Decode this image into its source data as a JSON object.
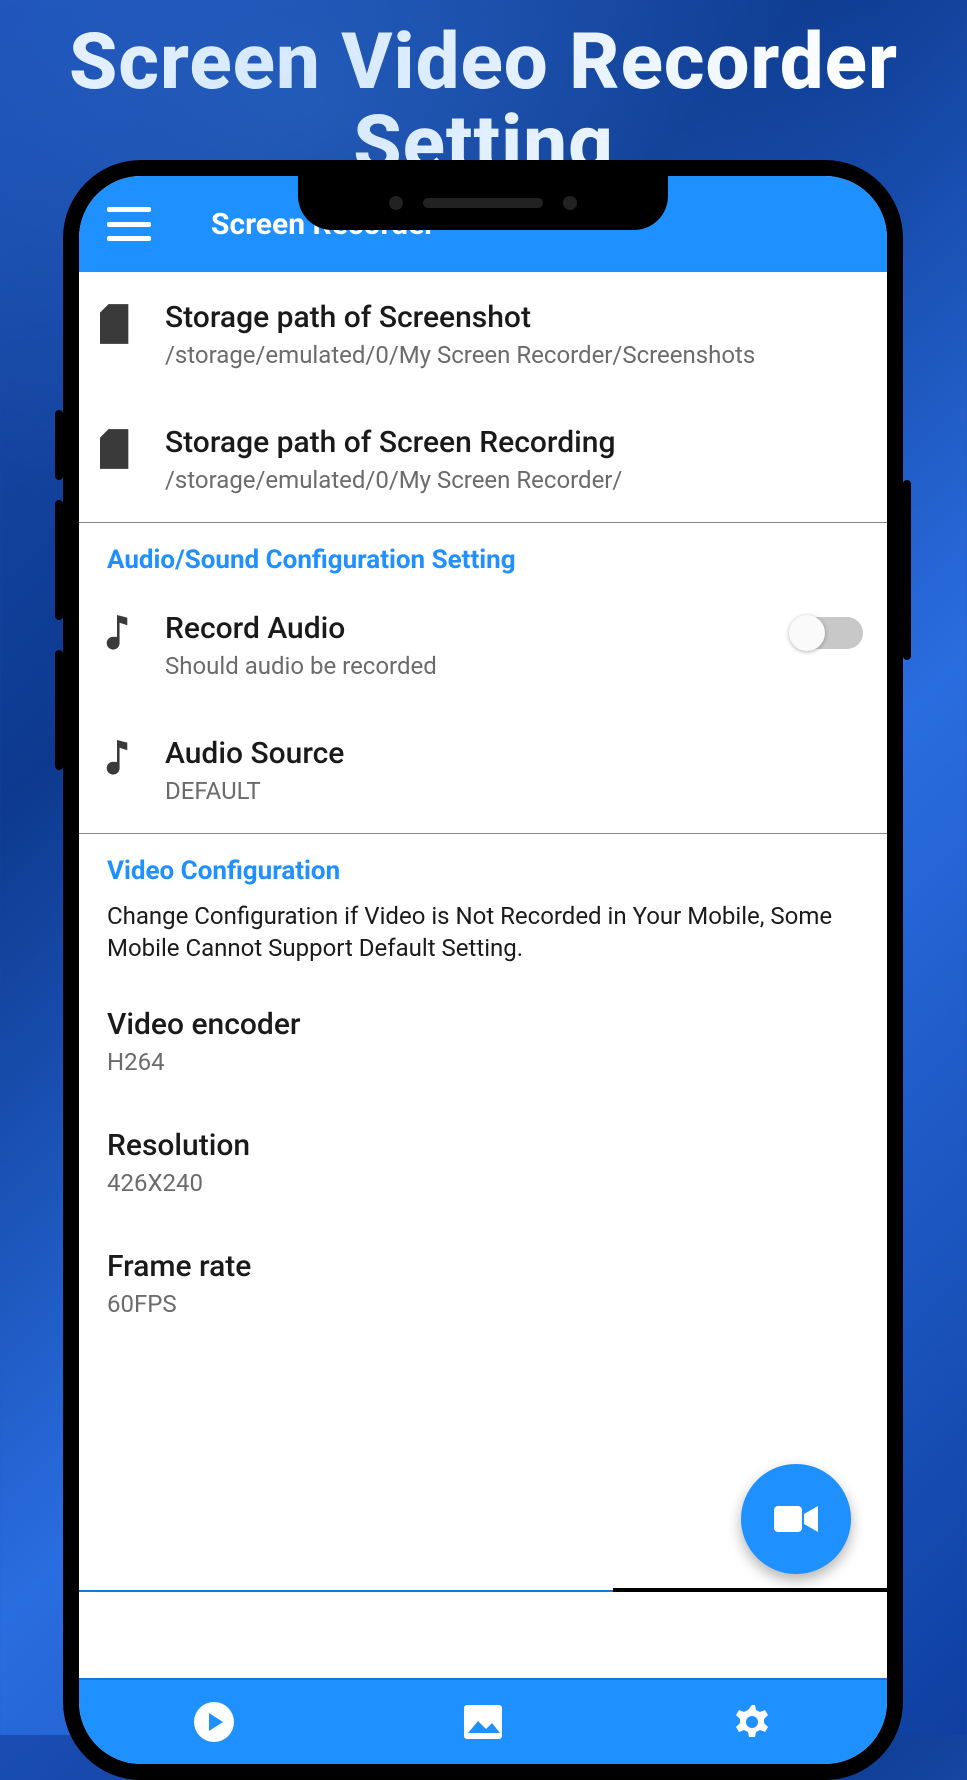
{
  "promo": {
    "line1": "Screen Video Recorder",
    "line2": "Setting"
  },
  "header": {
    "title": "Screen Recorder"
  },
  "storage": {
    "screenshot": {
      "title": "Storage path of Screenshot",
      "path": "/storage/emulated/0/My Screen Recorder/Screenshots"
    },
    "recording": {
      "title": "Storage path of Screen Recording",
      "path": "/storage/emulated/0/My Screen Recorder/"
    }
  },
  "audio_section": {
    "header": "Audio/Sound Configuration Setting",
    "record": {
      "title": "Record Audio",
      "sub": "Should audio be recorded",
      "enabled": false
    },
    "source": {
      "title": "Audio Source",
      "value": "DEFAULT"
    }
  },
  "video_section": {
    "header": "Video Configuration",
    "note": "Change Configuration if Video is Not Recorded in Your Mobile, Some Mobile Cannot Support Default Setting.",
    "encoder": {
      "title": "Video encoder",
      "value": "H264"
    },
    "resolution": {
      "title": "Resolution",
      "value": "426X240"
    },
    "framerate": {
      "title": "Frame rate",
      "value": "60FPS"
    }
  },
  "colors": {
    "accent": "#1e90ff"
  }
}
